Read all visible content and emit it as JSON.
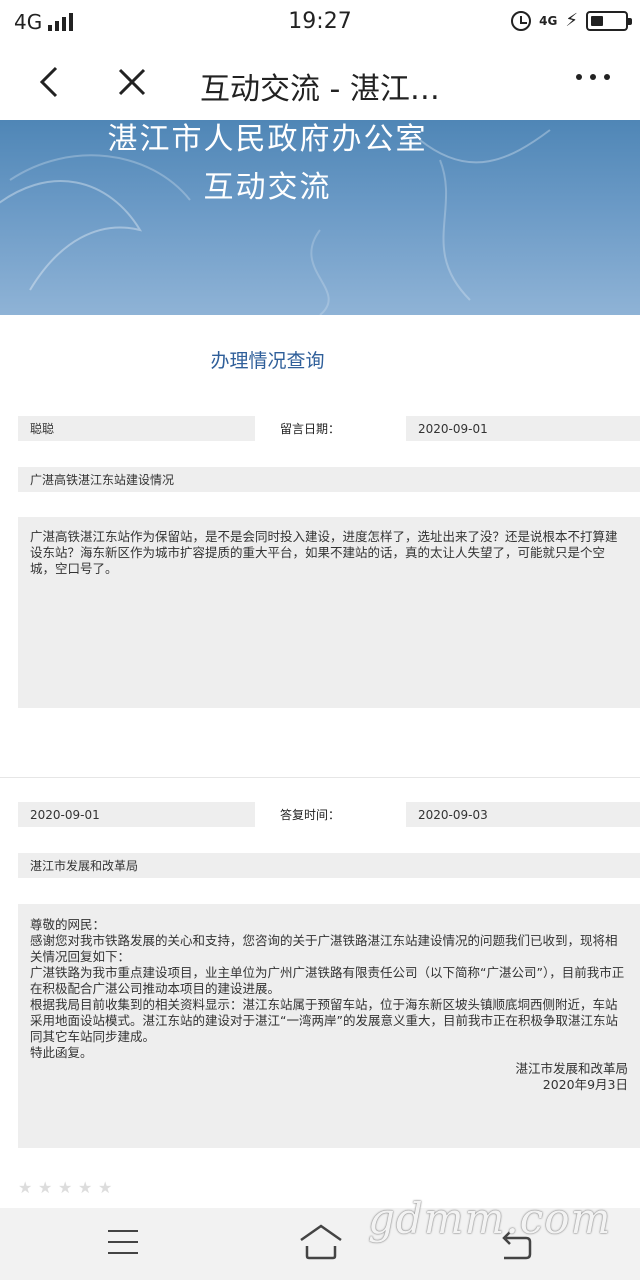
{
  "status": {
    "network": "4G",
    "time": "19:27",
    "network_small": "4G"
  },
  "nav": {
    "title": "互动交流 - 湛江…"
  },
  "banner": {
    "line1": "湛江市人民政府办公室",
    "line2": "互动交流"
  },
  "section_title": "办理情况查询",
  "message": {
    "name": "聪聪",
    "date_label": "留言日期：",
    "date": "2020-09-01",
    "subject": "广湛高铁湛江东站建设情况",
    "content": "广湛高铁湛江东站作为保留站，是不是会同时投入建设，进度怎样了，选址出来了没？还是说根本不打算建设东站？海东新区作为城市扩容提质的重大平台，如果不建站的话，真的太让人失望了，可能就只是个空城，空口号了。"
  },
  "reply": {
    "msg_date": "2020-09-01",
    "reply_label": "答复时间：",
    "reply_date": "2020-09-03",
    "department": "湛江市发展和改革局",
    "lines": [
      "尊敬的网民：",
      "感谢您对我市铁路发展的关心和支持，您咨询的关于广湛铁路湛江东站建设情况的问题我们已收到，现将相关情况回复如下：",
      "广湛铁路为我市重点建设项目，业主单位为广州广湛铁路有限责任公司（以下简称“广湛公司”），目前我市正在积极配合广湛公司推动本项目的建设进展。",
      "根据我局目前收集到的相关资料显示：湛江东站属于预留车站，位于海东新区坡头镇顺底垌西侧附近，车站采用地面设站模式。湛江东站的建设对于湛江“一湾两岸”的发展意义重大，目前我市正在积极争取湛江东站同其它车站同步建成。",
      "特此函复。"
    ],
    "signature": "湛江市发展和改革局",
    "signature_date": "2020年9月3日"
  },
  "rating": {
    "stars": 5,
    "filled": 0
  },
  "watermark": "gdmm.com"
}
